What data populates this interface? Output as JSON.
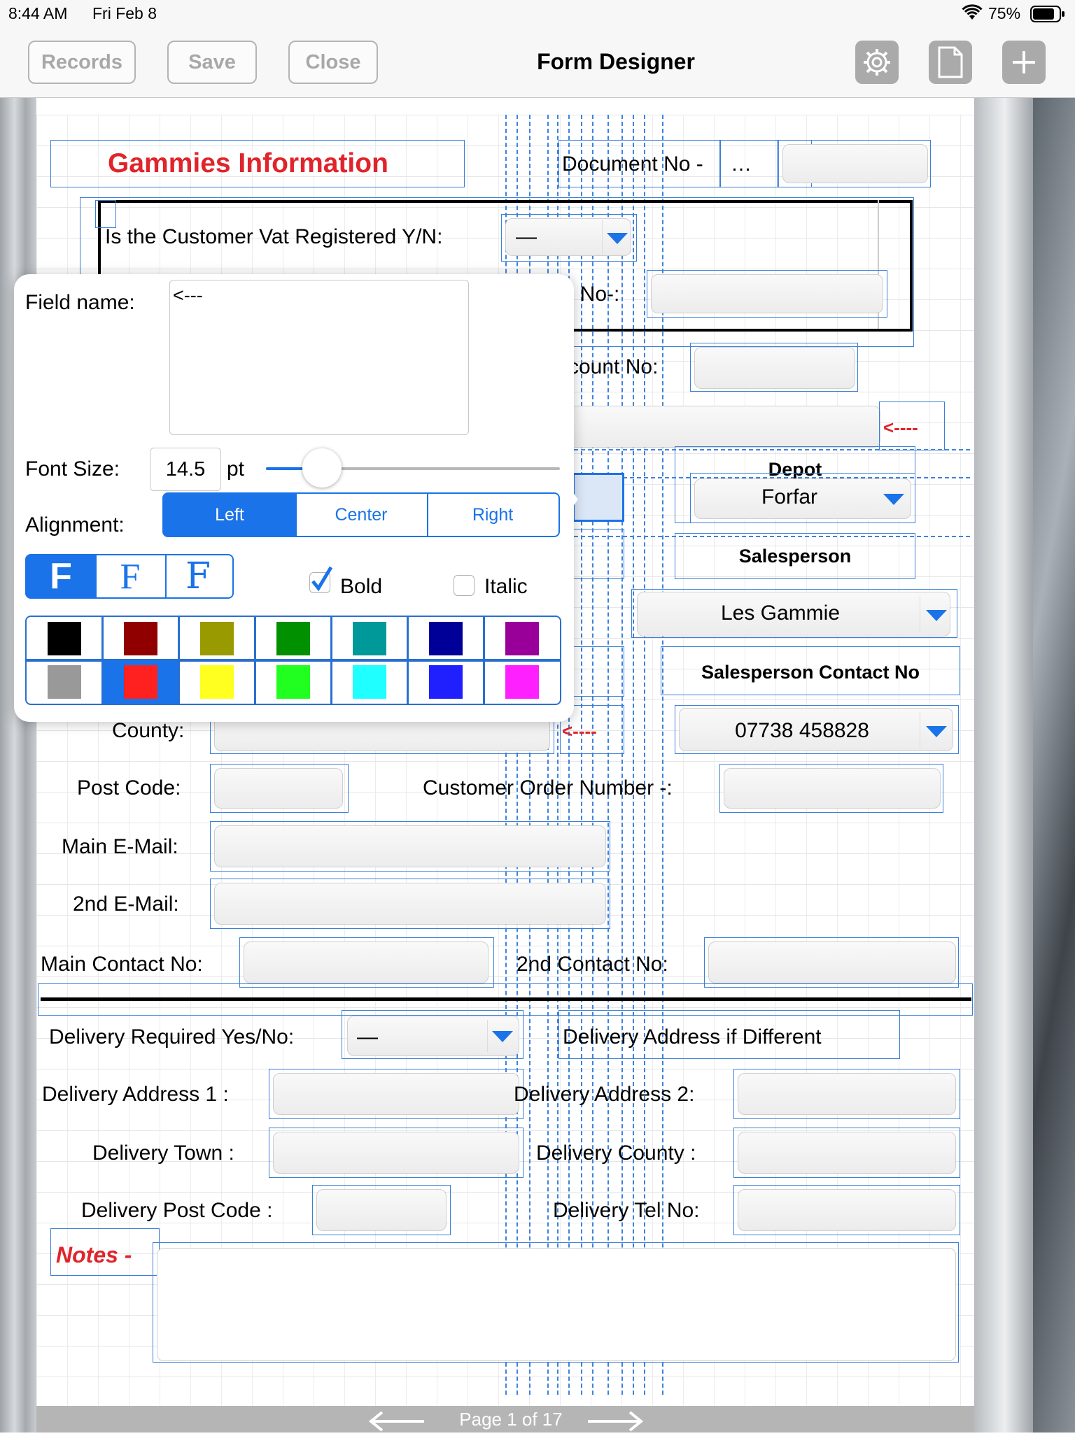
{
  "status_bar": {
    "time": "8:44 AM",
    "date": "Fri Feb 8",
    "battery": "75%"
  },
  "toolbar": {
    "records": "Records",
    "save": "Save",
    "close": "Close",
    "title": "Form Designer",
    "icons": [
      "gear-icon",
      "document-icon",
      "plus-icon"
    ]
  },
  "form": {
    "header_title": "Gammies Information",
    "document_no_label": "Document No -",
    "document_no_value": "…",
    "vat_label": "Is the Customer Vat Registered Y/N:",
    "vat_value": "—",
    "vat_no_label": ". No-:",
    "account_no_label": "count No:",
    "arrow_text": "<----",
    "depot_label": "Depot",
    "depot_value": "Forfar",
    "salesperson_label": "Salesperson",
    "salesperson_value": "Les Gammie",
    "salesperson_contact_label": "Salesperson Contact No",
    "salesperson_contact_value": "07738 458828",
    "county_label": "County:",
    "post_code_label": "Post Code:",
    "customer_order_label": "Customer Order Number -:",
    "main_email_label": "Main E-Mail:",
    "second_email_label": "2nd E-Mail:",
    "main_contact_label": "Main Contact No:",
    "second_contact_label": "2nd Contact No:",
    "delivery_required_label": "Delivery Required Yes/No:",
    "delivery_required_value": "—",
    "delivery_if_different_label": "Delivery Address if Different",
    "delivery_address1_label": "Delivery Address 1 :",
    "delivery_address2_label": "Delivery Address 2:",
    "delivery_town_label": "Delivery Town :",
    "delivery_county_label": "Delivery County :",
    "delivery_postcode_label": "Delivery Post Code :",
    "delivery_tel_label": "Delivery Tel No:",
    "notes_label": "Notes -"
  },
  "popup": {
    "field_name_label": "Field name:",
    "field_name_value": "<---",
    "font_size_label": "Font Size:",
    "font_size_value": "14.5",
    "font_size_unit": "pt",
    "font_size_slider_fraction": 0.19,
    "alignment_label": "Alignment:",
    "alignment_options": [
      "Left",
      "Center",
      "Right"
    ],
    "alignment_selected": "Left",
    "font_style_glyph": "F",
    "bold_label": "Bold",
    "bold_checked": true,
    "italic_label": "Italic",
    "italic_checked": false,
    "colors": [
      "#000000",
      "#900000",
      "#999900",
      "#009000",
      "#009999",
      "#000099",
      "#990099",
      "#999999",
      "#ff2020",
      "#ffff20",
      "#20ff20",
      "#20ffff",
      "#2020ff",
      "#ff20ff"
    ],
    "selected_color": "#ff2020"
  },
  "pager": {
    "label": "Page 1 of 17"
  }
}
